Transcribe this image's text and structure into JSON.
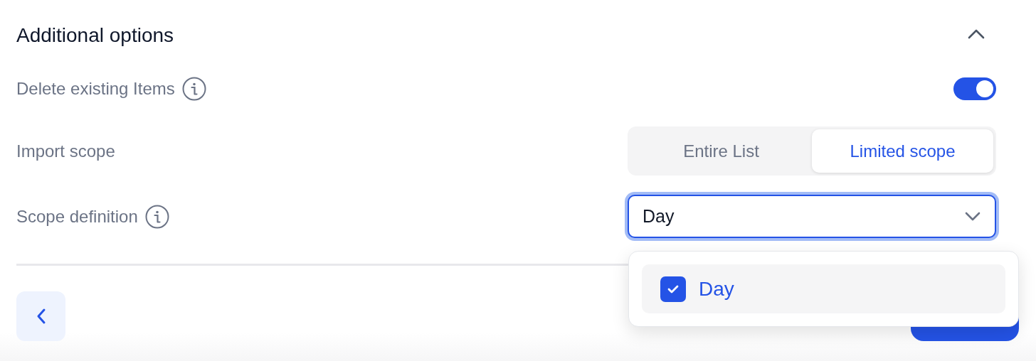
{
  "section": {
    "title": "Additional options",
    "expanded": true
  },
  "options": [
    {
      "kind": "toggle",
      "label": "Delete existing Items",
      "info": true,
      "on": true
    },
    {
      "kind": "segmented",
      "label": "Import scope",
      "info": false,
      "segments": [
        {
          "label": "Entire List",
          "selected": false
        },
        {
          "label": "Limited scope",
          "selected": true
        }
      ]
    },
    {
      "kind": "select",
      "label": "Scope definition",
      "info": true,
      "value": "Day",
      "focused": true,
      "open": true,
      "choices": [
        {
          "label": "Day",
          "checked": true
        }
      ]
    }
  ]
}
